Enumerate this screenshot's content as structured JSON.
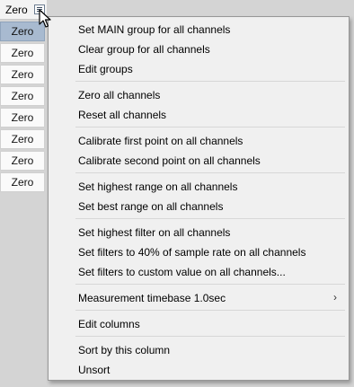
{
  "column": {
    "header_label": "Zero",
    "header_menu_icon": "list-menu-icon",
    "cells": [
      "Zero",
      "Zero",
      "Zero",
      "Zero",
      "Zero",
      "Zero",
      "Zero",
      "Zero"
    ]
  },
  "menu": {
    "items": [
      {
        "label": "Set MAIN group for all channels"
      },
      {
        "label": "Clear group for all channels"
      },
      {
        "label": "Edit groups"
      },
      {
        "label": "Zero all channels"
      },
      {
        "label": "Reset all channels"
      },
      {
        "label": "Calibrate first point on all channels"
      },
      {
        "label": "Calibrate second point on all channels"
      },
      {
        "label": "Set highest range on all channels"
      },
      {
        "label": "Set best range on all channels"
      },
      {
        "label": "Set highest filter on all channels"
      },
      {
        "label": "Set filters to 40% of sample rate on all channels"
      },
      {
        "label": "Set filters to custom value on all channels..."
      },
      {
        "label": "Measurement timebase 1.0sec",
        "submenu_arrow": "›"
      },
      {
        "label": "Edit columns"
      },
      {
        "label": "Sort by this column"
      },
      {
        "label": "Unsort"
      }
    ]
  }
}
